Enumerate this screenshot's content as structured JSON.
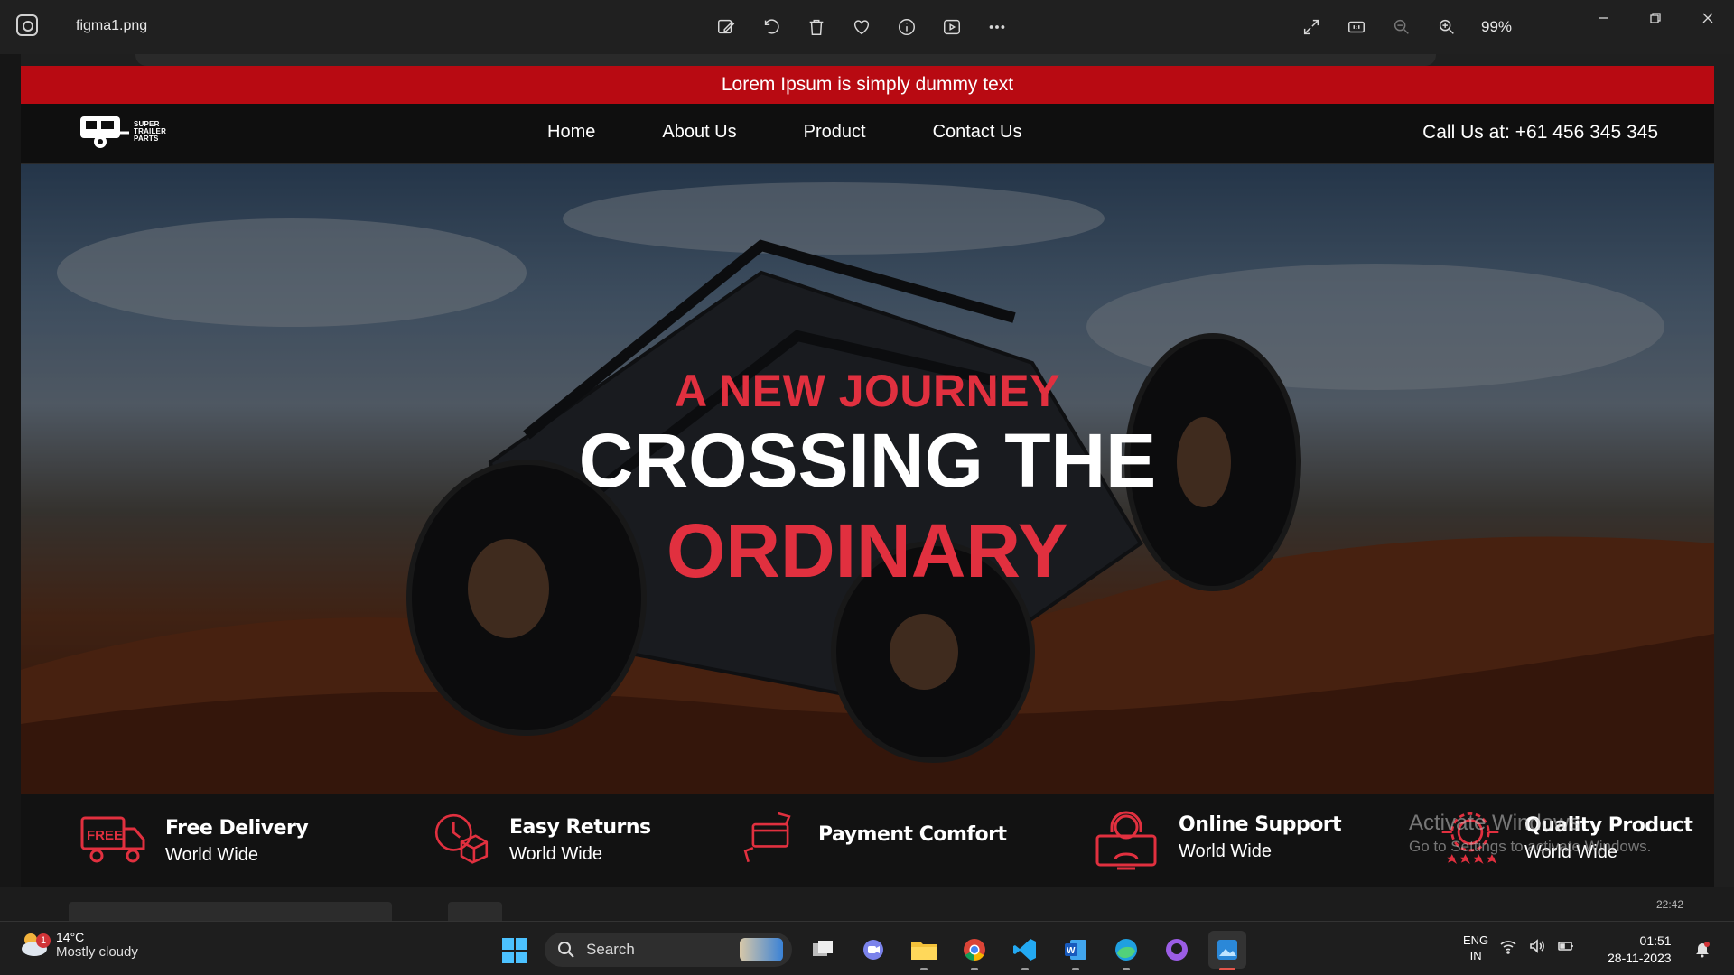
{
  "viewer": {
    "filename": "figma1.png",
    "zoom": "99%",
    "tools": [
      "edit-icon",
      "rotate-icon",
      "delete-icon",
      "favorite-icon",
      "info-icon",
      "slideshow-icon",
      "more-icon"
    ],
    "right_tools": [
      "fullscreen-icon",
      "actual-size-icon",
      "zoom-out-icon",
      "zoom-in-icon"
    ]
  },
  "site": {
    "promo": "Lorem Ipsum is simply dummy text",
    "logo_lines": [
      "SUPER",
      "TRAILER",
      "PARTS"
    ],
    "nav": [
      "Home",
      "About Us",
      "Product",
      "Contact Us"
    ],
    "phone": "Call Us at: +61 456 345 345",
    "hero": {
      "kicker": "A NEW JOURNEY",
      "line1": "CROSSING THE",
      "line2": "ORDINARY"
    },
    "features": [
      {
        "title": "Free Delivery",
        "subtitle": "World Wide",
        "icon": "free-delivery-truck-icon"
      },
      {
        "title": "Easy Returns",
        "subtitle": "World Wide",
        "icon": "easy-returns-box-icon"
      },
      {
        "title": "Payment Comfort",
        "subtitle": "",
        "icon": "payment-card-icon"
      },
      {
        "title": "Online Support",
        "subtitle": "World Wide",
        "icon": "online-support-agent-icon"
      },
      {
        "title": "Quality Product",
        "subtitle": "World Wide",
        "icon": "quality-badge-icon"
      }
    ],
    "accent": "#e1303f",
    "promo_color": "#b80a12"
  },
  "watermark": {
    "line1": "Activate Windows",
    "line2": "Go to Settings to activate Windows."
  },
  "thumb_time": "22:42",
  "taskbar": {
    "weather_temp": "14°C",
    "weather_desc": "Mostly cloudy",
    "weather_badge": "1",
    "search": "Search",
    "lang_top": "ENG",
    "lang_bottom": "IN",
    "time": "01:51",
    "date": "28-11-2023"
  }
}
